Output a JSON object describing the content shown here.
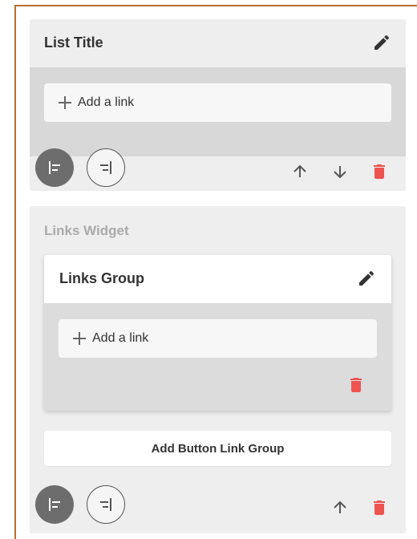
{
  "colors": {
    "accent_border": "#b8702a",
    "delete": "#ef5350",
    "card_bg": "#eeeeee"
  },
  "list_card": {
    "title": "List Title",
    "add_link_label": "Add a link",
    "icons": [
      "pencil-icon",
      "plus-icon",
      "align-left-icon",
      "align-right-icon",
      "arrow-up-icon",
      "arrow-down-icon",
      "trash-icon"
    ]
  },
  "links_widget": {
    "label": "Links Widget",
    "group": {
      "title": "Links Group",
      "add_link_label": "Add a link"
    },
    "add_group_button_label": "Add Button Link Group",
    "icons": [
      "pencil-icon",
      "plus-icon",
      "trash-icon",
      "align-left-icon",
      "align-right-icon",
      "arrow-up-icon"
    ]
  }
}
